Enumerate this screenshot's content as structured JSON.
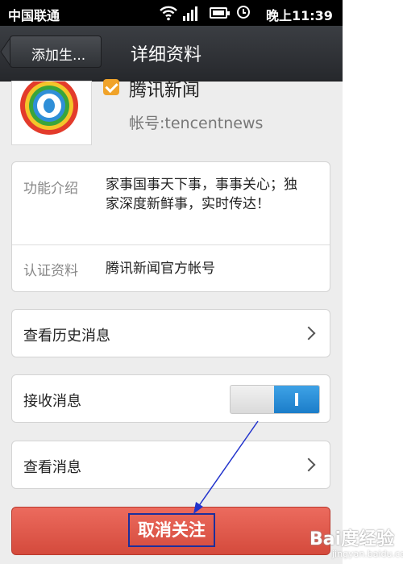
{
  "status_bar": {
    "carrier": "中国联通",
    "time": "晚上11:39",
    "icons": [
      "wifi-icon",
      "signal-icon",
      "battery-icon",
      "clock-icon"
    ]
  },
  "nav": {
    "back_label": "添加生...",
    "title": "详细资料"
  },
  "profile": {
    "name": "腾讯新闻",
    "account": "帐号:tencentnews",
    "verified_icon": "verified-icon",
    "avatar_icon": "tencent-news-logo"
  },
  "info": {
    "intro_label": "功能介绍",
    "intro_value": "家事国事天下事，事事关心；独家深度新鲜事，实时传达！",
    "cert_label": "认证资料",
    "cert_value": "腾讯新闻官方帐号"
  },
  "rows": {
    "history_label": "查看历史消息",
    "receive_label": "接收消息",
    "receive_enabled": true,
    "view_label": "查看消息"
  },
  "unfollow_label": "取消关注",
  "watermark": {
    "main": "Bai度经验",
    "sub": "jingyan.baidu.com"
  },
  "colors": {
    "accent_blue": "#2b8fdc",
    "danger_red": "#e05a4c",
    "navbar": "#2f3236",
    "verified_orange": "#f0a32a"
  }
}
